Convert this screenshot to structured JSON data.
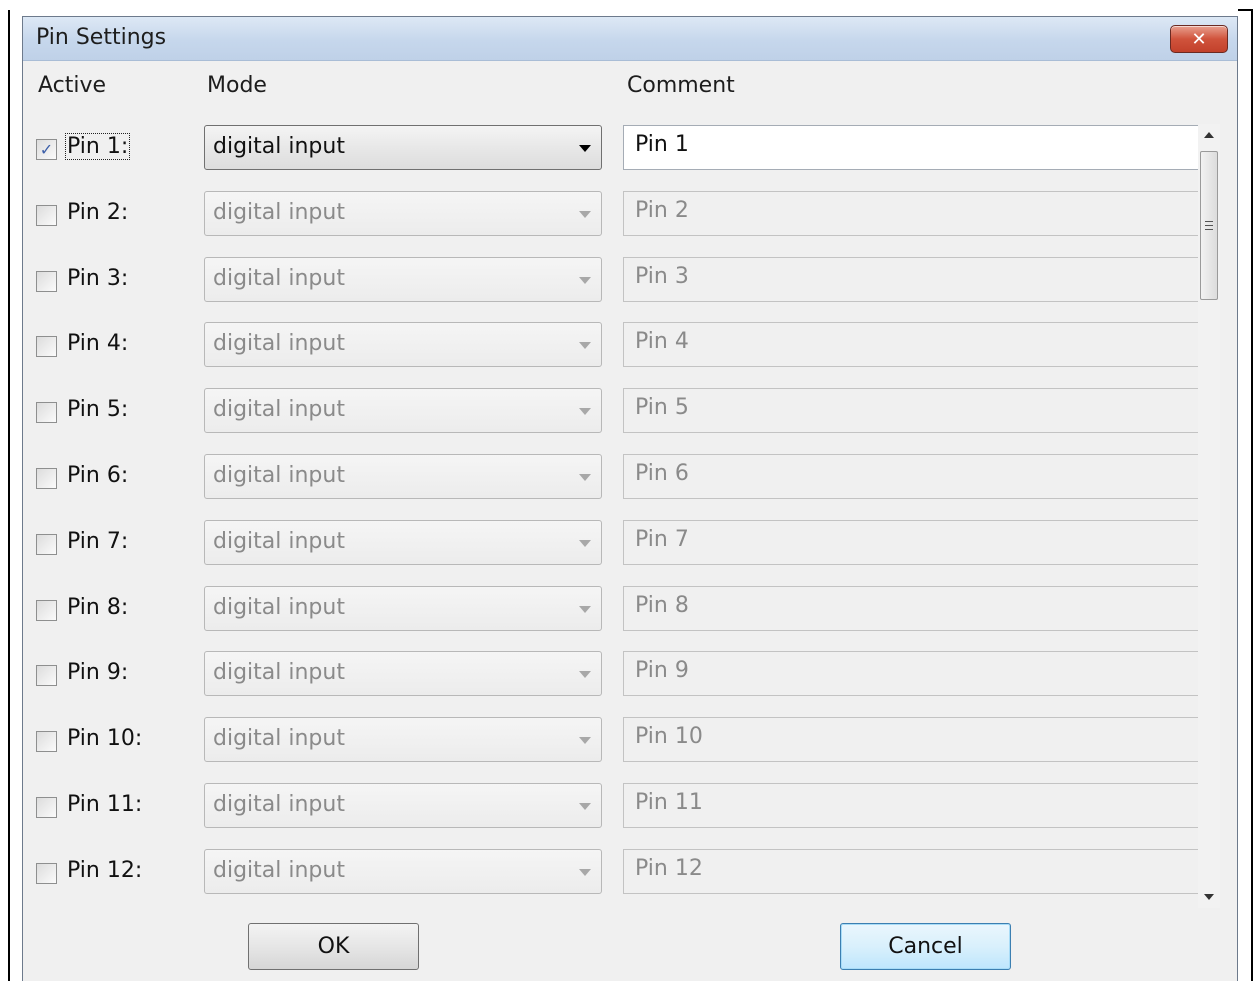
{
  "window": {
    "title": "Pin Settings",
    "close_symbol": "✕"
  },
  "headers": {
    "active": "Active",
    "mode": "Mode",
    "comment": "Comment"
  },
  "pins": [
    {
      "label": "Pin 1:",
      "checked": true,
      "mode": "digital input",
      "comment": "Pin 1"
    },
    {
      "label": "Pin 2:",
      "checked": false,
      "mode": "digital input",
      "comment": "Pin 2"
    },
    {
      "label": "Pin 3:",
      "checked": false,
      "mode": "digital input",
      "comment": "Pin 3"
    },
    {
      "label": "Pin 4:",
      "checked": false,
      "mode": "digital input",
      "comment": "Pin 4"
    },
    {
      "label": "Pin 5:",
      "checked": false,
      "mode": "digital input",
      "comment": "Pin 5"
    },
    {
      "label": "Pin 6:",
      "checked": false,
      "mode": "digital input",
      "comment": "Pin 6"
    },
    {
      "label": "Pin 7:",
      "checked": false,
      "mode": "digital input",
      "comment": "Pin 7"
    },
    {
      "label": "Pin 8:",
      "checked": false,
      "mode": "digital input",
      "comment": "Pin 8"
    },
    {
      "label": "Pin 9:",
      "checked": false,
      "mode": "digital input",
      "comment": "Pin 9"
    },
    {
      "label": "Pin 10:",
      "checked": false,
      "mode": "digital input",
      "comment": "Pin 10"
    },
    {
      "label": "Pin 11:",
      "checked": false,
      "mode": "digital input",
      "comment": "Pin 11"
    },
    {
      "label": "Pin 12:",
      "checked": false,
      "mode": "digital input",
      "comment": "Pin 12"
    }
  ],
  "buttons": {
    "ok": "OK",
    "cancel": "Cancel"
  },
  "icons": {
    "close": "close-icon",
    "dropdown": "chevron-down-icon",
    "scroll_up": "scroll-up-icon",
    "scroll_down": "scroll-down-icon",
    "checkmark": "checkmark-icon"
  },
  "colors": {
    "window_bg": "#f0f0f0",
    "titlebar": "#c6d7ec",
    "close_button": "#c2412b",
    "checkmark": "#3c5fa8",
    "cancel_button": "#bee6fd"
  }
}
